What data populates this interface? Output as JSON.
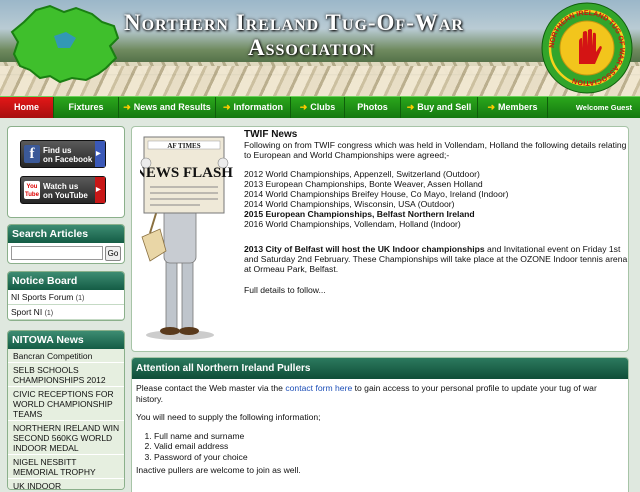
{
  "header": {
    "title_line1": "Northern Ireland Tug-Of-War",
    "title_line2": "Association",
    "badge_text": "NORTHERN IRELAND TUG OF WAR ASSOCIATION"
  },
  "nav": {
    "items": [
      "Home",
      "Fixtures",
      "News and Results",
      "Information",
      "Clubs",
      "Photos",
      "Buy and Sell",
      "Members"
    ],
    "welcome": "Welcome Guest",
    "active": "Home"
  },
  "social": {
    "facebook_line1": "Find us",
    "facebook_line2": "on Facebook",
    "youtube_line1": "Watch us",
    "youtube_line2": "on YouTube",
    "youtube_logo": "You Tube"
  },
  "search": {
    "title": "Search Articles",
    "placeholder": "",
    "button": "Go"
  },
  "notice": {
    "title": "Notice Board",
    "items": [
      {
        "label": "NI Sports Forum",
        "count": "(1)"
      },
      {
        "label": "Sport NI",
        "count": "(1)"
      }
    ]
  },
  "news": {
    "title": "NITOWA News",
    "items": [
      "Bancran Competition",
      "SELB SCHOOLS CHAMPIONSHIPS 2012",
      "CIVIC RECEPTIONS FOR WORLD CHAMPIONSHIP TEAMS",
      "NORTHERN IRELAND WIN SECOND 560KG WORLD INDOOR MEDAL",
      "NIGEL NESBITT MEMORIAL TROPHY",
      "UK INDOOR CHAMPIONSHIPS"
    ]
  },
  "article": {
    "newspaper_name": "AF TIMES",
    "newspaper_headline": "NEWS FLASH",
    "title": "TWIF News",
    "intro": "Following on from TWIF congress which was held in Vollendam, Holland the following details relating to European and World Championships were agreed;-",
    "events": [
      {
        "text": "2012  World Championships, Appenzell, Switzerland (Outdoor)",
        "bold": false
      },
      {
        "text": "2013  European Championships, Bonte Weaver, Assen Holland",
        "bold": false
      },
      {
        "text": "2014  World Championships Breifey House, Co Mayo, Ireland (Indoor)",
        "bold": false
      },
      {
        "text": "2014  World Championships, Wisconsin, USA (Outdoor)",
        "bold": false
      },
      {
        "text": "2015  European Championships, Belfast Northern Ireland",
        "bold": true
      },
      {
        "text": "2016  World Championships, Vollendam, Holland (Indoor)",
        "bold": false
      }
    ],
    "p2_bold": "2013 City of Belfast will host the UK Indoor championships",
    "p2_rest": " and Invitational event on Friday 1st and Saturday 2nd February.  These Championships will take place at the OZONE Indoor tennis arena at Ormeau Park, Belfast.",
    "p3": "Full details to follow..."
  },
  "attention": {
    "title": "Attention all Northern Ireland Pullers",
    "p1_pre": "Please contact the Web master via the ",
    "p1_link": "contact form here",
    "p1_post": " to gain access to your personal profile to update your tug of war history.",
    "p2": "You will need to supply the following information;",
    "list": [
      "Full name and surname",
      "Valid email address",
      "Password of your choice"
    ],
    "p3": "Inactive pullers are welcome to join as well."
  },
  "colors": {
    "nav_green": "#1f8f18",
    "nav_home_red": "#c81414",
    "panel_teal": "#145c45",
    "link_blue": "#1d4fb8"
  }
}
